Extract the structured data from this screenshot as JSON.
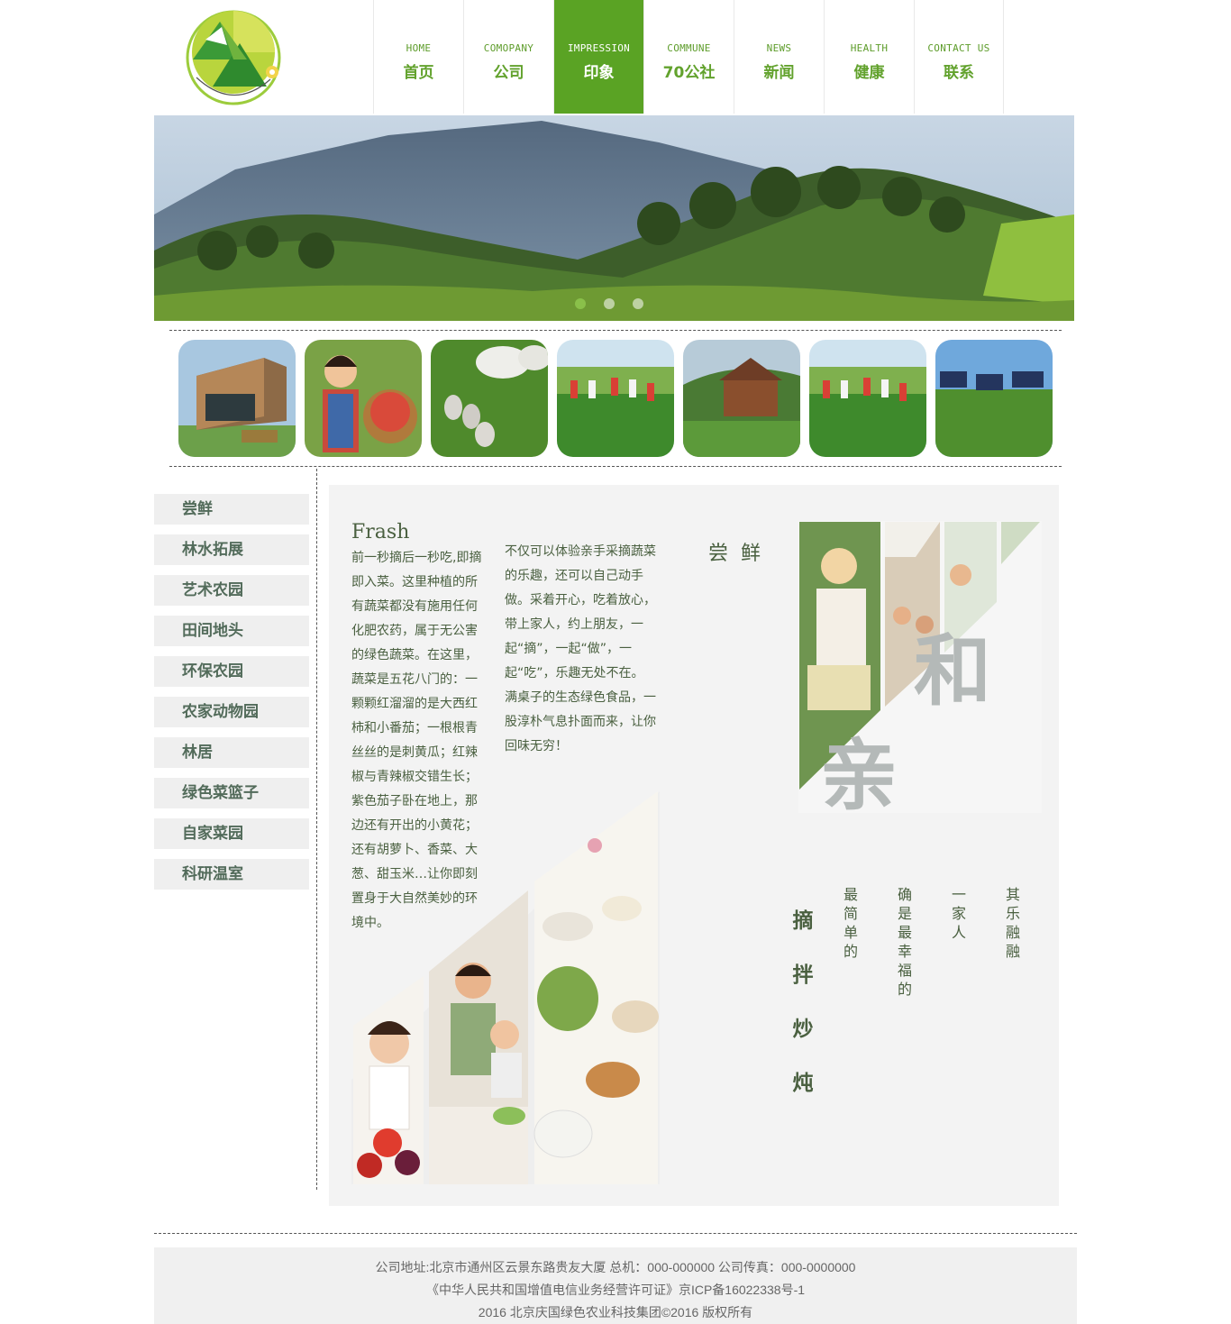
{
  "nav": [
    {
      "en": "HOME",
      "zh": "首页"
    },
    {
      "en": "COMOPANY",
      "zh": "公司"
    },
    {
      "en": "IMPRESSION",
      "zh": "印象"
    },
    {
      "en": "COMMUNE",
      "zh": "70公社"
    },
    {
      "en": "NEWS",
      "zh": "新闻"
    },
    {
      "en": "HEALTH",
      "zh": "健康"
    },
    {
      "en": "CONTACT US",
      "zh": "联系"
    }
  ],
  "nav_active_index": 2,
  "banner": {
    "slide_count": 3,
    "active_slide": 1
  },
  "sidebar": [
    "尝鲜",
    "林水拓展",
    "艺术农园",
    "田间地头",
    "环保农园",
    "农家动物园",
    "林居",
    "绿色菜篮子",
    "自家菜园",
    "科研温室"
  ],
  "content": {
    "title": "Frash",
    "para1": "前一秒摘后一秒吃,即摘即入菜。这里种植的所有蔬菜都没有施用任何化肥农药，属于无公害的绿色蔬菜。在这里，蔬菜是五花八门的：一颗颗红溜溜的是大西红柿和小番茄；一根根青丝丝的是刺黄瓜；红辣椒与青辣椒交错生长；紫色茄子卧在地上，那边还有开出的小黄花；还有胡萝卜、香菜、大葱、甜玉米…让你即刻置身于大自然美妙的环境中。",
    "para2": "不仅可以体验亲手采摘蔬菜的乐趣，还可以自己动手做。采着开心，吃着放心，带上家人，约上朋友，一起“摘”，一起“做”，一起“吃”，乐趣无处不在。满桌子的生态绿色食品，一股淳朴气息扑面而来，让你回味无穷！",
    "taste_heading": "尝鲜",
    "vertical_big": "摘拌炒炖",
    "vertical_cols": [
      "最简单的",
      "确是最幸福的",
      "一家人",
      "其乐融融"
    ],
    "overlay_chars": [
      "和",
      "亲"
    ]
  },
  "footer": {
    "line1": "公司地址:北京市通州区云景东路贵友大厦 总机：000-000000 公司传真：000-0000000",
    "line2": "《中华人民共和国增值电信业务经营许可证》京ICP备16022338号-1",
    "line3": "2016 北京庆国绿色农业科技集团©2016 版权所有"
  },
  "colors": {
    "accent": "#5aa324",
    "nav_text": "#62a22d",
    "body_text": "#4a6040"
  },
  "icons": {
    "logo": "green-triangle-logo"
  }
}
